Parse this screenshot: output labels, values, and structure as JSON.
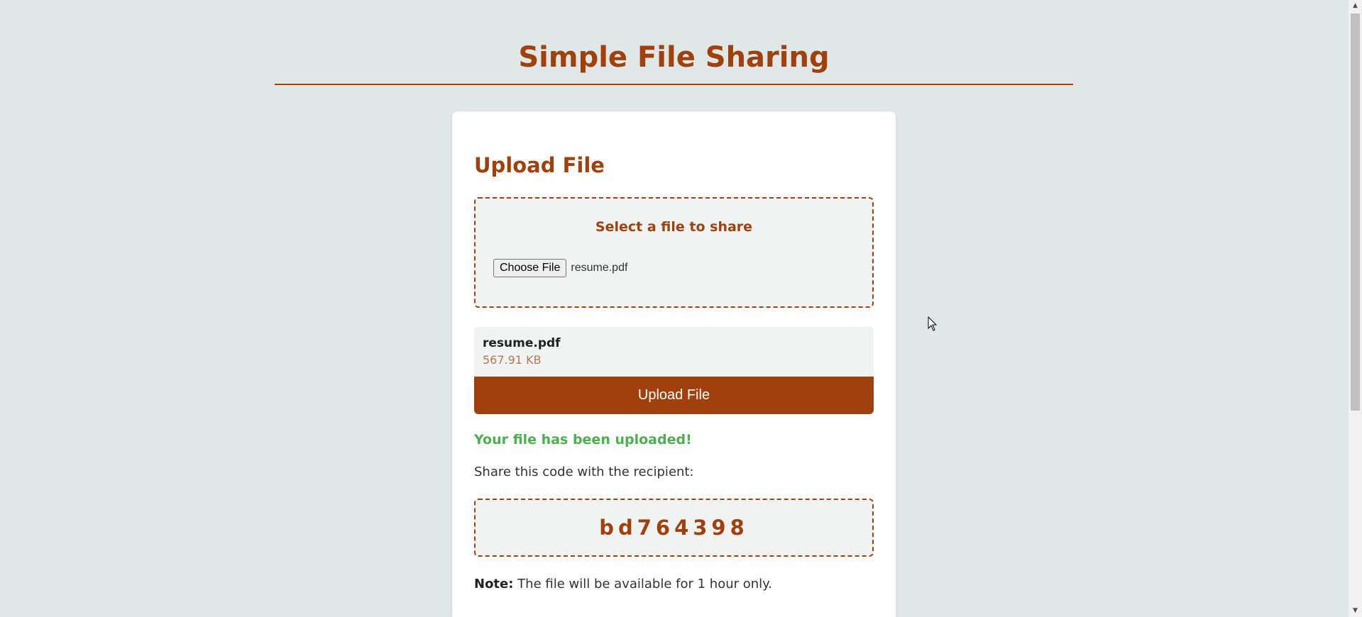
{
  "header": {
    "title": "Simple File Sharing"
  },
  "upload": {
    "title": "Upload File",
    "dropzone_label": "Select a file to share",
    "choose_button_label": "Choose File",
    "chosen_file_name": "resume.pdf"
  },
  "file_info": {
    "name": "resume.pdf",
    "size": "567.91 KB"
  },
  "upload_button_label": "Upload File",
  "result": {
    "success_message": "Your file has been uploaded!",
    "share_label": "Share this code with the recipient:",
    "code": "bd764398"
  },
  "note": {
    "label": "Note:",
    "text": " The file will be available for 1 hour only."
  },
  "colors": {
    "accent": "#a0410d",
    "success": "#4caf50",
    "background": "#dfe7e7",
    "muted_size": "#b07a55"
  },
  "icons": {
    "cursor": "mouse-pointer-icon",
    "scroll_up": "scroll-up-arrow-icon",
    "scroll_down": "scroll-down-arrow-icon"
  }
}
